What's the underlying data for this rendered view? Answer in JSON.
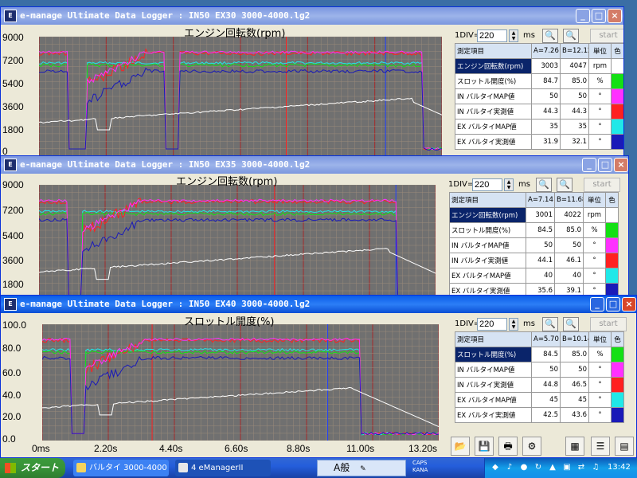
{
  "colors": {
    "engine_speed": "#ffffff",
    "throttle": "#14e014",
    "in_valve_map": "#ff30ff",
    "in_valve_actual": "#ff2020",
    "ex_valve_map": "#20e8e8",
    "ex_valve_actual": "#1a1ab8",
    "plot_bg": "#707070",
    "grid_major": "#a52a2a",
    "grid_minor": "#9a8a7a",
    "cursor_a": "#ff2020",
    "cursor_b": "#2040ff"
  },
  "windows": [
    {
      "title": "e-manage Ultimate Data Logger : IN50 EX30 3000-4000.lg2",
      "plot_title": "エンジン回転数(rpm)",
      "y_ticks": [
        "9000",
        "7200",
        "5400",
        "3600",
        "1800",
        "0"
      ],
      "div_label": "1DIV=",
      "div_value": "220",
      "ms_label": "ms",
      "start_label": "start",
      "table": {
        "headers": [
          "測定項目",
          "A=7.26",
          "B=12.12",
          "単位",
          "色"
        ],
        "rows": [
          {
            "name": "エンジン回転数(rpm)",
            "a": "3003",
            "b": "4047",
            "unit": "rpm",
            "color": "#ffffff",
            "selected": true
          },
          {
            "name": "スロットル開度(%)",
            "a": "84.7",
            "b": "85.0",
            "unit": "%",
            "color": "#14e014",
            "selected": false
          },
          {
            "name": "IN バルタイMAP値",
            "a": "50",
            "b": "50",
            "unit": "°",
            "color": "#ff30ff",
            "selected": false
          },
          {
            "name": "IN バルタイ実測値",
            "a": "44.3",
            "b": "44.3",
            "unit": "°",
            "color": "#ff2020",
            "selected": false
          },
          {
            "name": "EX バルタイMAP値",
            "a": "35",
            "b": "35",
            "unit": "°",
            "color": "#20e8e8",
            "selected": false
          },
          {
            "name": "EX バルタイ実測値",
            "a": "31.9",
            "b": "32.1",
            "unit": "°",
            "color": "#1a1ab8",
            "selected": false
          }
        ]
      }
    },
    {
      "title": "e-manage Ultimate Data Logger : IN50 EX35 3000-4000.lg2",
      "plot_title": "エンジン回転数(rpm)",
      "y_ticks": [
        "9000",
        "7200",
        "5400",
        "3600",
        "1800"
      ],
      "div_label": "1DIV=",
      "div_value": "220",
      "ms_label": "ms",
      "start_label": "start",
      "table": {
        "headers": [
          "測定項目",
          "A=7.14",
          "B=11.68",
          "単位",
          "色"
        ],
        "rows": [
          {
            "name": "エンジン回転数(rpm)",
            "a": "3001",
            "b": "4022",
            "unit": "rpm",
            "color": "#ffffff",
            "selected": true
          },
          {
            "name": "スロットル開度(%)",
            "a": "84.5",
            "b": "85.0",
            "unit": "%",
            "color": "#14e014",
            "selected": false
          },
          {
            "name": "IN バルタイMAP値",
            "a": "50",
            "b": "50",
            "unit": "°",
            "color": "#ff30ff",
            "selected": false
          },
          {
            "name": "IN バルタイ実測値",
            "a": "44.1",
            "b": "46.1",
            "unit": "°",
            "color": "#ff2020",
            "selected": false
          },
          {
            "name": "EX バルタイMAP値",
            "a": "40",
            "b": "40",
            "unit": "°",
            "color": "#20e8e8",
            "selected": false
          },
          {
            "name": "EX バルタイ実測値",
            "a": "35.6",
            "b": "39.1",
            "unit": "°",
            "color": "#1a1ab8",
            "selected": false
          }
        ]
      }
    },
    {
      "title": "e-manage Ultimate Data Logger : IN50 EX40 3000-4000.lg2",
      "plot_title": "スロットル開度(%)",
      "y_ticks": [
        "100.0",
        "80.0",
        "60.0",
        "40.0",
        "20.0",
        "0.0"
      ],
      "x_ticks": [
        "0ms",
        "2.20s",
        "4.40s",
        "6.60s",
        "8.80s",
        "11.00s",
        "13.20s"
      ],
      "div_label": "1DIV=",
      "div_value": "220",
      "ms_label": "ms",
      "start_label": "start",
      "table": {
        "headers": [
          "測定項目",
          "A=5.70",
          "B=10.14",
          "単位",
          "色"
        ],
        "rows": [
          {
            "name": "スロットル開度(%)",
            "a": "84.5",
            "b": "85.0",
            "unit": "%",
            "color": "#14e014",
            "selected": true
          },
          {
            "name": "IN バルタイMAP値",
            "a": "50",
            "b": "50",
            "unit": "°",
            "color": "#ff30ff",
            "selected": false
          },
          {
            "name": "IN バルタイ実測値",
            "a": "44.8",
            "b": "46.5",
            "unit": "°",
            "color": "#ff2020",
            "selected": false
          },
          {
            "name": "EX バルタイMAP値",
            "a": "45",
            "b": "45",
            "unit": "°",
            "color": "#20e8e8",
            "selected": false
          },
          {
            "name": "EX バルタイ実測値",
            "a": "42.5",
            "b": "43.6",
            "unit": "°",
            "color": "#1a1ab8",
            "selected": false
          }
        ]
      }
    }
  ],
  "taskbar": {
    "start_label": "スタート",
    "tasks": [
      {
        "label": "バルタイ 3000-4000 -...",
        "active": false
      },
      {
        "label": "4 eManagerII",
        "active": true
      }
    ],
    "ime_label": "A般",
    "caps_label": "CAPS",
    "kana_label": "KANA",
    "clock": "13:42"
  },
  "toolbar_icons": [
    "open-folder-icon",
    "save-icon",
    "print-icon",
    "settings-icon",
    "chart-grid-icon",
    "list-icon",
    "graph-icon"
  ]
}
